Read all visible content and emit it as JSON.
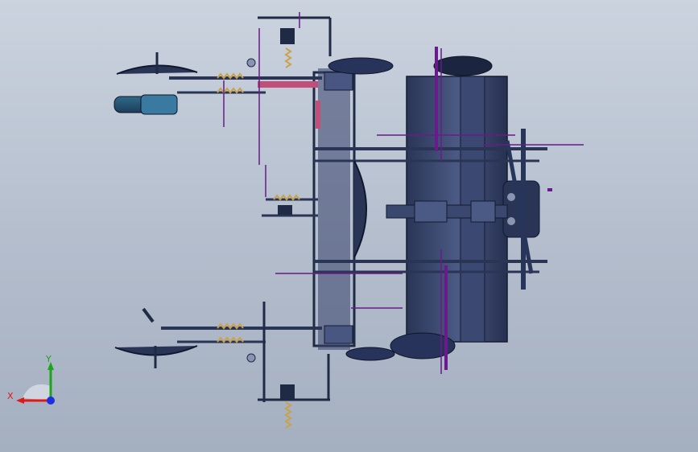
{
  "viewport": {
    "name": "solidworks-graphics-area",
    "background_top": "#cbd3df",
    "background_bottom": "#a4afc0"
  },
  "triad": {
    "x_label": "X",
    "y_label": "Y",
    "x_color": "#e01818",
    "y_color": "#1aa51a",
    "z_color": "#1a2fe0"
  },
  "colors": {
    "steel_dark": "#1f2a44",
    "steel_mid": "#39466a",
    "steel_light": "#5c6a90",
    "highlight_pink": "#c0507a",
    "spring": "#c9a24a",
    "annotation_purple": "#6a1a8a"
  }
}
